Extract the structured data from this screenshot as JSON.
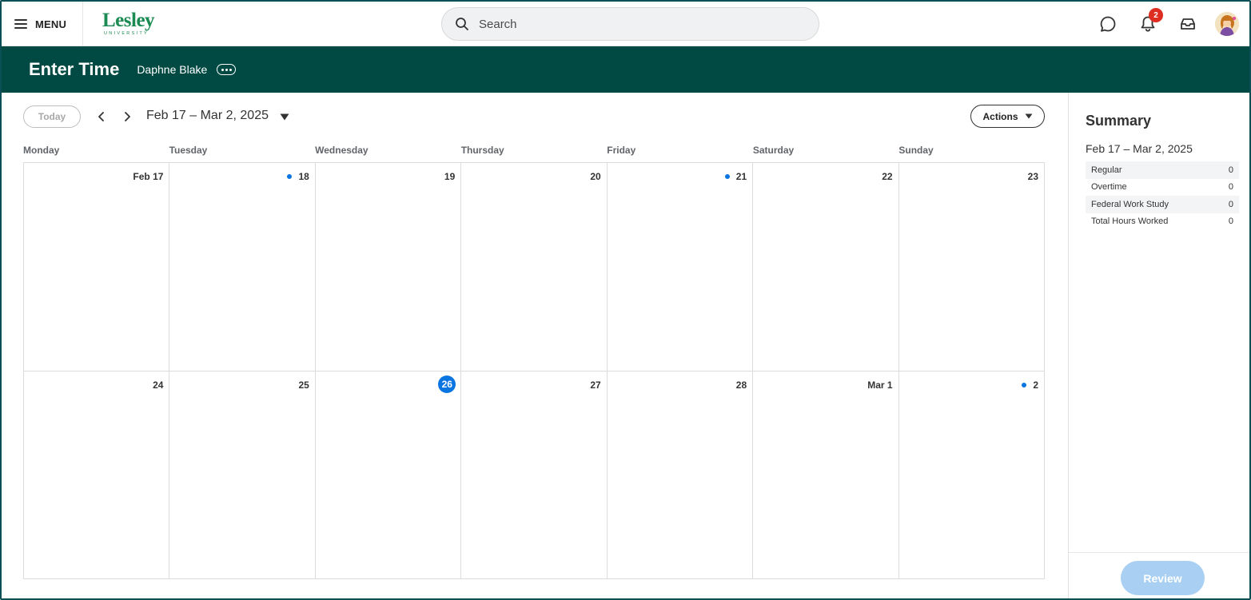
{
  "topbar": {
    "menu_label": "MENU",
    "logo_word": "Lesley",
    "logo_sub": "UNIVERSITY",
    "search_placeholder": "Search",
    "notifications_count": "2"
  },
  "header": {
    "title": "Enter Time",
    "worker_name": "Daphne Blake"
  },
  "toolbar": {
    "today_label": "Today",
    "range_label": "Feb 17 – Mar 2, 2025",
    "actions_label": "Actions"
  },
  "calendar": {
    "weekdays": [
      "Monday",
      "Tuesday",
      "Wednesday",
      "Thursday",
      "Friday",
      "Saturday",
      "Sunday"
    ],
    "days": [
      {
        "label": "Feb 17",
        "dot": false,
        "today": false
      },
      {
        "label": "18",
        "dot": true,
        "today": false
      },
      {
        "label": "19",
        "dot": false,
        "today": false
      },
      {
        "label": "20",
        "dot": false,
        "today": false
      },
      {
        "label": "21",
        "dot": true,
        "today": false
      },
      {
        "label": "22",
        "dot": false,
        "today": false
      },
      {
        "label": "23",
        "dot": false,
        "today": false
      },
      {
        "label": "24",
        "dot": false,
        "today": false
      },
      {
        "label": "25",
        "dot": false,
        "today": false
      },
      {
        "label": "26",
        "dot": false,
        "today": true
      },
      {
        "label": "27",
        "dot": false,
        "today": false
      },
      {
        "label": "28",
        "dot": false,
        "today": false
      },
      {
        "label": "Mar 1",
        "dot": false,
        "today": false
      },
      {
        "label": "2",
        "dot": true,
        "today": false
      }
    ]
  },
  "summary": {
    "title": "Summary",
    "range": "Feb 17 – Mar 2, 2025",
    "rows": [
      {
        "label": "Regular",
        "value": "0"
      },
      {
        "label": "Overtime",
        "value": "0"
      },
      {
        "label": "Federal Work Study",
        "value": "0"
      },
      {
        "label": "Total Hours Worked",
        "value": "0"
      }
    ],
    "review_label": "Review"
  },
  "colors": {
    "header_bg": "#004a43",
    "brand_green": "#1b8a53",
    "accent_blue": "#0875e1",
    "badge_red": "#de2e21"
  },
  "icons": [
    "hamburger-icon",
    "search-icon",
    "chat-icon",
    "bell-icon",
    "inbox-icon",
    "chevron-left-icon",
    "chevron-right-icon",
    "caret-down-icon",
    "more-icon"
  ]
}
